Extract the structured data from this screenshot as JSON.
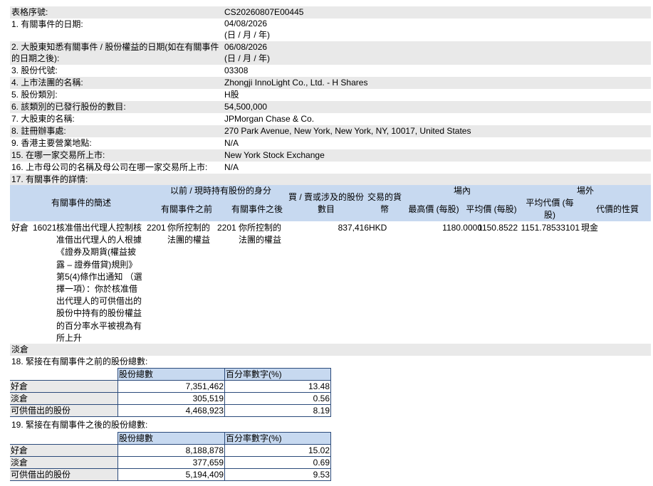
{
  "fields": [
    {
      "label": "表格序號:",
      "value": "CS20260807E00445",
      "shade": true
    },
    {
      "label": "1. 有關事件的日期:",
      "value": "04/08/2026",
      "value2": "(日 / 月 / 年)",
      "shade": false
    },
    {
      "label": "2. 大股東知悉有關事件 / 股份權益的日期(如在有關事件",
      "label2": "的日期之後):",
      "value": "06/08/2026",
      "value2": "(日 / 月 / 年)",
      "shade": true
    },
    {
      "label": "3. 股份代號:",
      "value": "03308",
      "shade": false
    },
    {
      "label": "4. 上市法團的名稱:",
      "value": "Zhongji InnoLight Co., Ltd. - H Shares",
      "shade": true
    },
    {
      "label": "5. 股份類別:",
      "value": "H股",
      "shade": false
    },
    {
      "label": "6. 該類別的已發行股份的數目:",
      "value": "54,500,000",
      "shade": true
    },
    {
      "label": "7. 大股東的名稱:",
      "value": "JPMorgan Chase & Co.",
      "shade": false
    },
    {
      "label": "8. 註冊辦事處:",
      "value": "270 Park Avenue, New York, New York, NY, 10017, United States",
      "shade": true
    },
    {
      "label": "9. 香港主要營業地點:",
      "value": "N/A",
      "shade": false
    },
    {
      "label": "15. 在哪一家交易所上市:",
      "value": "New York Stock Exchange",
      "shade": true
    },
    {
      "label": "16. 上市母公司的名稱及母公司在哪一家交易所上市:",
      "value": "N/A",
      "shade": false
    },
    {
      "label": "17. 有關事件的詳情:",
      "value": "",
      "shade": true
    }
  ],
  "event_header": {
    "brief": "有關事件的簡述",
    "capacity_group": "以前 / 現時持有股份的身分",
    "before": "有關事件之前",
    "after": "有關事件之後",
    "shares_involved": "買 / 賣或涉及的股份數目",
    "currency": "交易的貨幣",
    "onex": "場內",
    "high_price": "最高價 (每股)",
    "avg_price": "平均價 (每股)",
    "offex": "場外",
    "avg_consideration": "平均代價 (每股)",
    "nature": "代價的性質"
  },
  "event_row": {
    "position": "好倉",
    "code": "16021",
    "description": "核准借出代理人控制核准借出代理人的人根據《證券及期貨(權益披露 – 證券借貸)規則》第5(4)條作出通知 （選擇一項）：你於核准借出代理人的可供借出的股份中持有的股份權益的百分率水平被視為有所上升",
    "before_code": "2201",
    "before_text": "你所控制的法團的權益",
    "after_code": "2201",
    "after_text": "你所控制的法團的權益",
    "shares": "837,416",
    "currency": "HKD",
    "high": "1180.0000",
    "avg": "1150.8522",
    "offex_avg": "1151.78533101",
    "nature": "現金"
  },
  "short_label": "淡倉",
  "sec18": {
    "title": "18. 緊接在有關事件之前的股份總數:",
    "col1": "股份總數",
    "col2": "百分率數字(%)",
    "rows": [
      {
        "label": "好倉",
        "shares": "7,351,462",
        "pct": "13.48"
      },
      {
        "label": "淡倉",
        "shares": "305,519",
        "pct": "0.56"
      },
      {
        "label": "可供借出的股份",
        "shares": "4,468,923",
        "pct": "8.19"
      }
    ]
  },
  "sec19": {
    "title": "19. 緊接在有關事件之後的股份總數:",
    "col1": "股份總數",
    "col2": "百分率數字(%)",
    "rows": [
      {
        "label": "好倉",
        "shares": "8,188,878",
        "pct": "15.02"
      },
      {
        "label": "淡倉",
        "shares": "377,659",
        "pct": "0.69"
      },
      {
        "label": "可供借出的股份",
        "shares": "5,194,409",
        "pct": "9.53"
      }
    ]
  },
  "colors": {
    "shade": "#e9e9e9",
    "header": "#c7d9f0",
    "border": "#2b4a7a"
  }
}
